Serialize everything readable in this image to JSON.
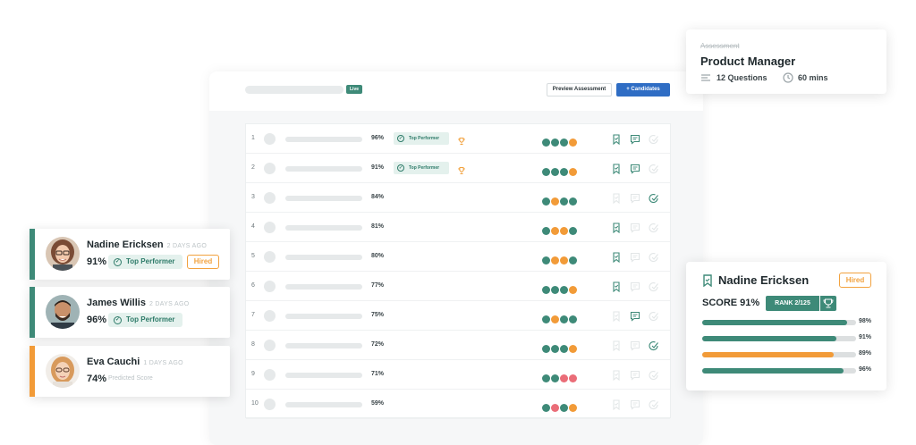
{
  "colors": {
    "green": "#3e8a78",
    "orange": "#f29b38",
    "red": "#ea6d78",
    "blue": "#2f6dc4",
    "bar_track": "#dcdfe0"
  },
  "header": {
    "live_badge": "Live",
    "preview_button": "Preview Assessment",
    "candidates_button": "+ Candidates"
  },
  "table": {
    "rows": [
      {
        "num": "1",
        "pct": "96%",
        "badge": "Top Performer",
        "trophy": true,
        "dots": [
          "green",
          "green",
          "green",
          "orange"
        ],
        "icons": {
          "bookmark": true,
          "comment": true,
          "check": false
        }
      },
      {
        "num": "2",
        "pct": "91%",
        "badge": "Top Performer",
        "trophy": true,
        "dots": [
          "green",
          "green",
          "green",
          "orange"
        ],
        "icons": {
          "bookmark": true,
          "comment": true,
          "check": false
        }
      },
      {
        "num": "3",
        "pct": "84%",
        "badge": "",
        "trophy": false,
        "dots": [
          "green",
          "orange",
          "green",
          "green"
        ],
        "icons": {
          "bookmark": false,
          "comment": false,
          "check": true
        }
      },
      {
        "num": "4",
        "pct": "81%",
        "badge": "",
        "trophy": false,
        "dots": [
          "green",
          "orange",
          "orange",
          "green"
        ],
        "icons": {
          "bookmark": true,
          "comment": false,
          "check": false
        }
      },
      {
        "num": "5",
        "pct": "80%",
        "badge": "",
        "trophy": false,
        "dots": [
          "green",
          "orange",
          "orange",
          "green"
        ],
        "icons": {
          "bookmark": true,
          "comment": false,
          "check": false
        }
      },
      {
        "num": "6",
        "pct": "77%",
        "badge": "",
        "trophy": false,
        "dots": [
          "green",
          "green",
          "green",
          "orange"
        ],
        "icons": {
          "bookmark": true,
          "comment": false,
          "check": false
        }
      },
      {
        "num": "7",
        "pct": "75%",
        "badge": "",
        "trophy": false,
        "dots": [
          "green",
          "orange",
          "green",
          "green"
        ],
        "icons": {
          "bookmark": false,
          "comment": true,
          "check": false
        }
      },
      {
        "num": "8",
        "pct": "72%",
        "badge": "",
        "trophy": false,
        "dots": [
          "green",
          "green",
          "green",
          "orange"
        ],
        "icons": {
          "bookmark": false,
          "comment": false,
          "check": true
        }
      },
      {
        "num": "9",
        "pct": "71%",
        "badge": "",
        "trophy": false,
        "dots": [
          "green",
          "green",
          "red",
          "red"
        ],
        "icons": {
          "bookmark": false,
          "comment": false,
          "check": false
        }
      },
      {
        "num": "10",
        "pct": "59%",
        "badge": "",
        "trophy": false,
        "dots": [
          "green",
          "red",
          "green",
          "orange"
        ],
        "icons": {
          "bookmark": false,
          "comment": false,
          "check": false
        }
      }
    ]
  },
  "assessment_card": {
    "label": "Assessment",
    "title": "Product Manager",
    "questions": "12 Questions",
    "duration": "60 mins"
  },
  "candidates": [
    {
      "name": "Nadine Ericksen",
      "days": "2 DAYS AGO",
      "pct": "91%",
      "badge": "Top Performer",
      "hired": "Hired",
      "predicted": "",
      "bar_color": "#3e8a78"
    },
    {
      "name": "James Willis",
      "days": "2 DAYS AGO",
      "pct": "96%",
      "badge": "Top Performer",
      "hired": "",
      "predicted": "",
      "bar_color": "#3e8a78"
    },
    {
      "name": "Eva Cauchi",
      "days": "1 DAYS AGO",
      "pct": "74%",
      "badge": "",
      "hired": "",
      "predicted": "Predicted Score",
      "bar_color": "#f29b38"
    }
  ],
  "score_card": {
    "name": "Nadine Ericksen",
    "hired": "Hired",
    "score": "SCORE 91%",
    "rank": "RANK 2/125",
    "bars": [
      {
        "value": 98,
        "label": "98%",
        "color": "#3e8a78"
      },
      {
        "value": 91,
        "label": "91%",
        "color": "#3e8a78"
      },
      {
        "value": 89,
        "label": "89%",
        "color": "#f29b38"
      },
      {
        "value": 96,
        "label": "96%",
        "color": "#3e8a78"
      }
    ]
  }
}
